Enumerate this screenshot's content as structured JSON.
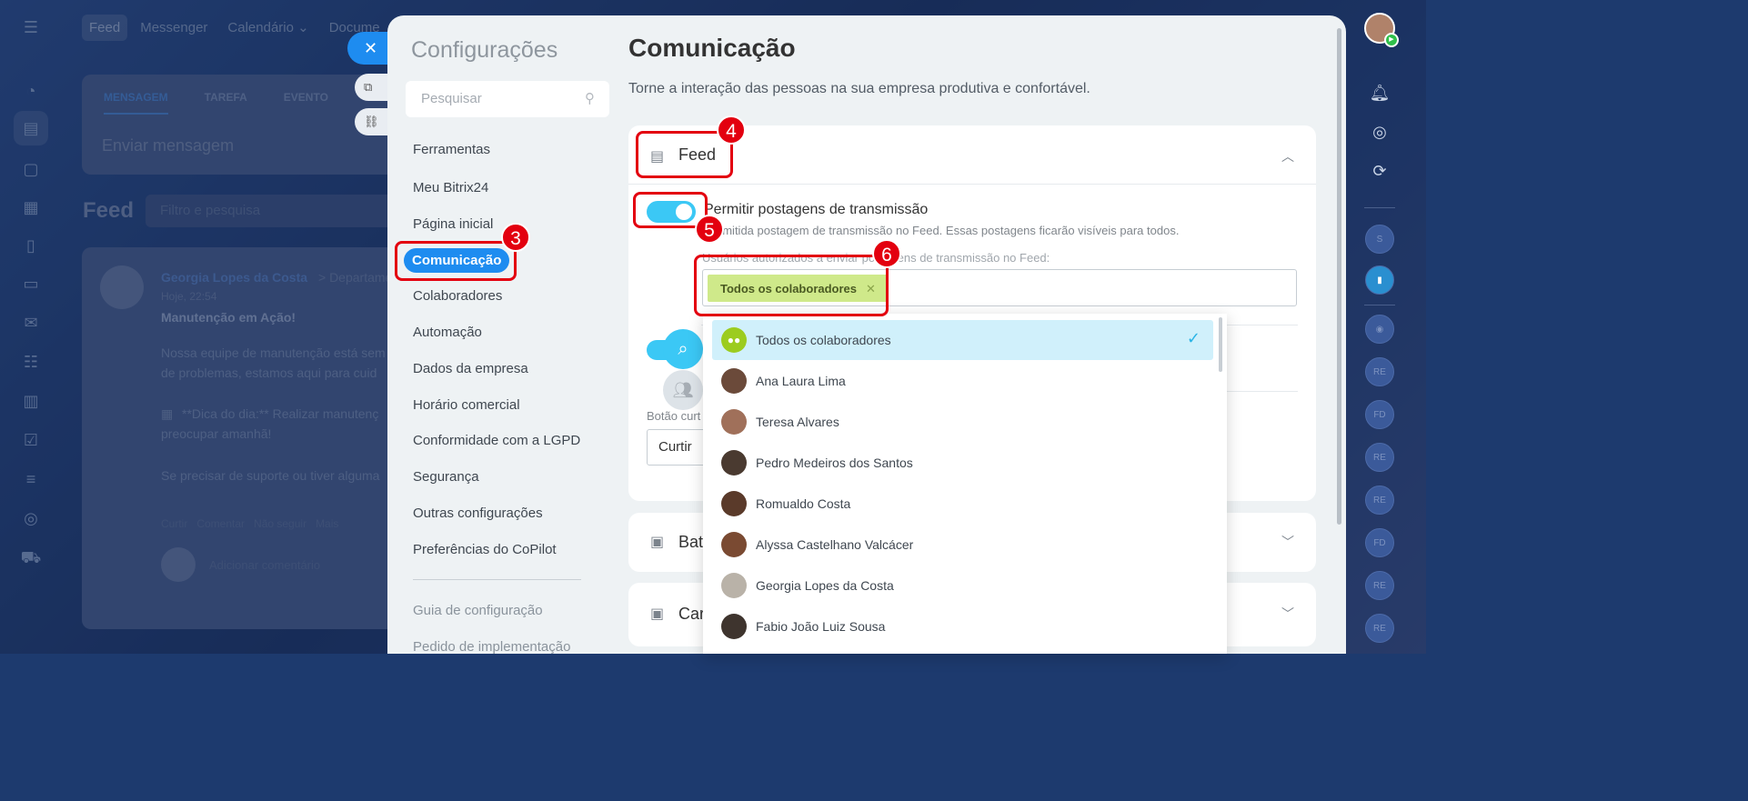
{
  "top_nav": {
    "tabs": [
      "Feed",
      "Messenger",
      "Calendário ⌄",
      "Docume"
    ]
  },
  "composer": {
    "tabs": [
      "MENSAGEM",
      "TAREFA",
      "EVENTO"
    ],
    "placeholder": "Enviar mensagem"
  },
  "feed": {
    "title": "Feed",
    "filter_placeholder": "Filtro e pesquisa",
    "post": {
      "author": "Georgia Lopes da Costa",
      "dept": "> Departamen",
      "time": "Hoje, 22:54",
      "title": "Manutenção em Ação!",
      "line1": "Nossa equipe de manutenção está sem",
      "line2": "de problemas, estamos aqui para cuid",
      "tip1": "**Dica do dia:** Realizar manutenç",
      "tip2": "preocupar amanhã!",
      "line3": "Se precisar de suporte ou tiver alguma",
      "actions": [
        "Curtir",
        "Comentar",
        "Não seguir",
        "Mais"
      ],
      "comment_placeholder": "Adicionar comentário"
    }
  },
  "settings": {
    "panel_title": "Configurações",
    "search_placeholder": "Pesquisar",
    "menu": [
      "Ferramentas",
      "Meu Bitrix24",
      "Página inicial",
      "Comunicação",
      "Colaboradores",
      "Automação",
      "Dados da empresa",
      "Horário comercial",
      "Conformidade com a LGPD",
      "Segurança",
      "Outras configurações",
      "Preferências do CoPilot"
    ],
    "footer_links": [
      "Guia de configuração",
      "Pedido de implementação"
    ],
    "main": {
      "title": "Comunicação",
      "description": "Torne a interação das pessoas na sua empresa produtiva e confortável.",
      "feed_card": {
        "header": "Feed",
        "option_label": "Permitir postagens de transmissão",
        "option_hint": "Permitida postagem de transmissão no Feed. Essas postagens ficarão visíveis para todos.",
        "field_label": "Usuários autorizados a enviar postagens de transmissão no Feed:",
        "chip": "Todos os colaboradores",
        "like_label": "Botão curt",
        "like_value": "Curtir"
      },
      "card2_header": "Bat",
      "card3_header": "Car"
    },
    "dropdown": [
      "Todos os colaboradores",
      "Ana Laura Lima",
      "Teresa Alvares",
      "Pedro Medeiros dos Santos",
      "Romualdo Costa",
      "Alyssa Castelhano Valcácer",
      "Georgia Lopes da Costa",
      "Fabio João Luiz Sousa"
    ]
  },
  "right_rail": {
    "initials": [
      "S",
      "RE",
      "FD",
      "RE",
      "RE",
      "FD",
      "RE",
      "RE"
    ]
  },
  "annotations": [
    "3",
    "4",
    "5",
    "6"
  ],
  "colors": {
    "accent": "#1e8cf0",
    "toggle": "#3bc8f5",
    "chip": "#cfe98a",
    "annotation": "#e3000f"
  }
}
